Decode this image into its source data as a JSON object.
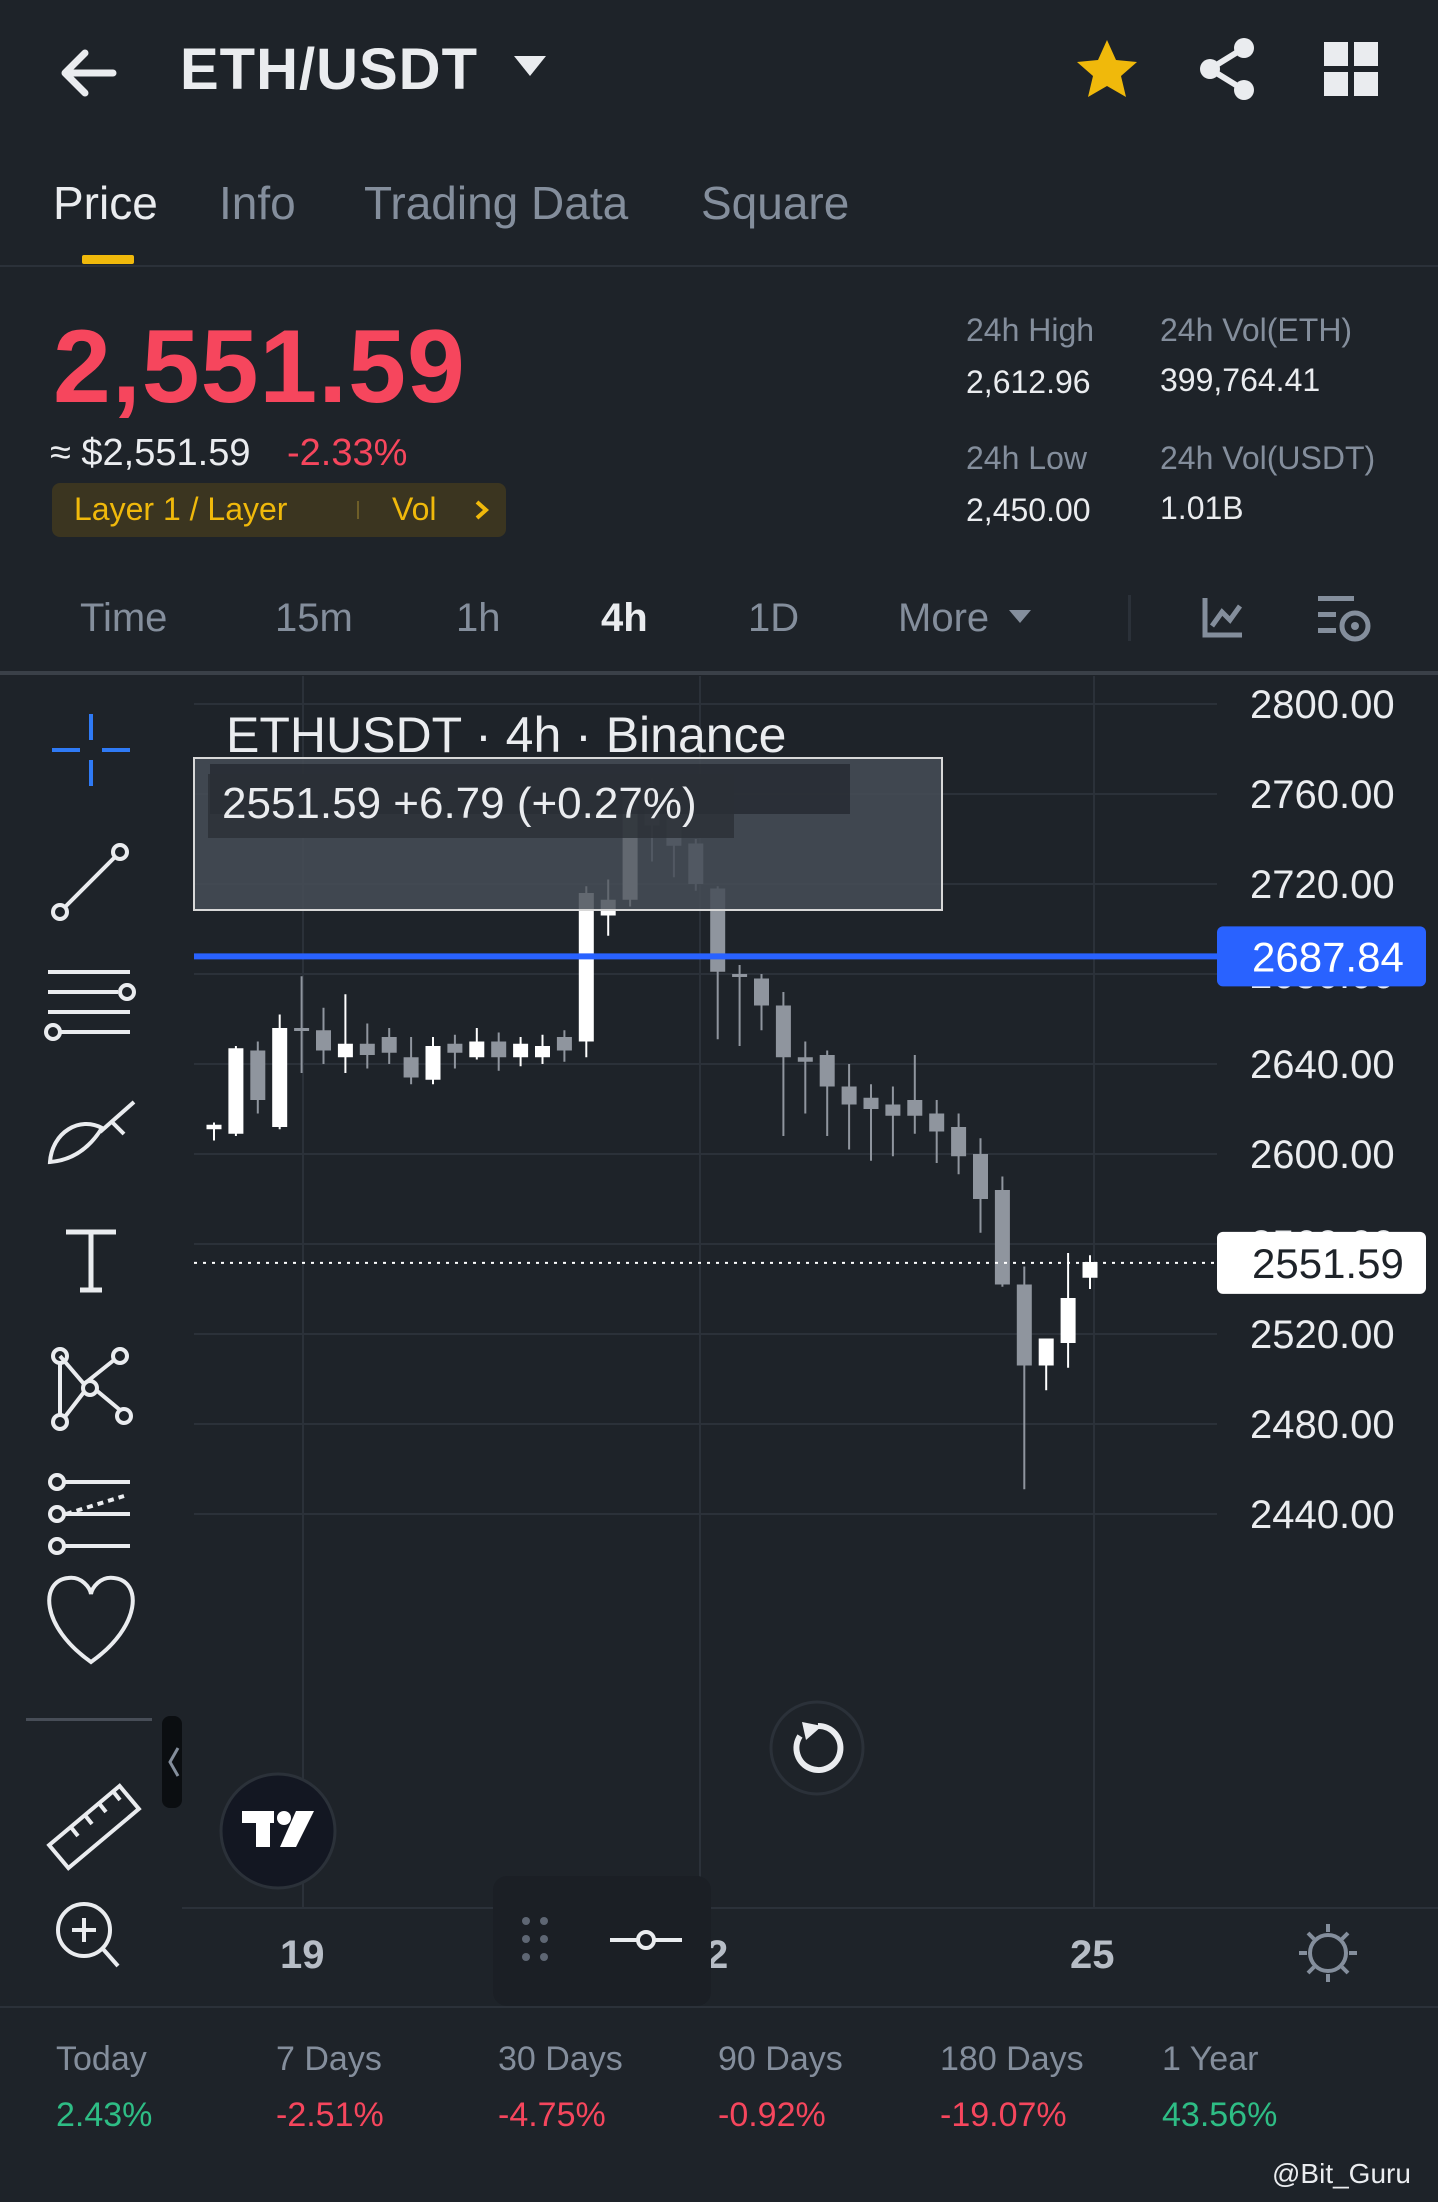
{
  "header": {
    "pair": "ETH/USDT",
    "accent": "#f0b90b"
  },
  "tabs": [
    {
      "label": "Price"
    },
    {
      "label": "Info"
    },
    {
      "label": "Trading Data"
    },
    {
      "label": "Square"
    }
  ],
  "price": {
    "last": "2,551.59",
    "usd": "≈ $2,551.59",
    "change": "-2.33%",
    "tag": "Layer 1 / Layer",
    "vol_link": "Vol",
    "down_color": "#f6465d",
    "up_color": "#2ebd85"
  },
  "stats": {
    "high_label": "24h High",
    "high_value": "2,612.96",
    "vol_eth_label": "24h Vol(ETH)",
    "vol_eth_value": "399,764.41",
    "low_label": "24h Low",
    "low_value": "2,450.00",
    "vol_usdt_label": "24h Vol(USDT)",
    "vol_usdt_value": "1.01B"
  },
  "timeframes": [
    "Time",
    "15m",
    "1h",
    "4h",
    "1D",
    "More"
  ],
  "active_timeframe": "4h",
  "chart": {
    "legend_title": "ETHUSDT · 4h · Binance",
    "legend_values": "2551.59  +6.79 (+0.27%)",
    "alert_line_label": "2687.84",
    "last_price_label": "2551.59",
    "x_labels": [
      "19",
      "2",
      "25"
    ]
  },
  "chart_data": {
    "type": "candlestick",
    "title": "ETHUSDT · 4h · Binance",
    "ylim": [
      2420,
      2820
    ],
    "y_ticks": [
      "2800.00",
      "2760.00",
      "2720.00",
      "2680.00",
      "2640.00",
      "2600.00",
      "2560.00",
      "2520.00",
      "2480.00",
      "2440.00"
    ],
    "x_labels": [
      "19",
      "2",
      "25"
    ],
    "horizontal_lines": [
      {
        "value": 2687.84,
        "color": "#2962ff"
      },
      {
        "value": 2551.59,
        "style": "dotted"
      }
    ],
    "candles": [
      {
        "o": 2611,
        "h": 2614,
        "l": 2606,
        "c": 2613
      },
      {
        "o": 2609,
        "h": 2648,
        "l": 2608,
        "c": 2647
      },
      {
        "o": 2646,
        "h": 2650,
        "l": 2618,
        "c": 2624
      },
      {
        "o": 2612,
        "h": 2662,
        "l": 2611,
        "c": 2656
      },
      {
        "o": 2656,
        "h": 2679,
        "l": 2636,
        "c": 2655
      },
      {
        "o": 2655,
        "h": 2665,
        "l": 2640,
        "c": 2646
      },
      {
        "o": 2643,
        "h": 2671,
        "l": 2636,
        "c": 2649
      },
      {
        "o": 2649,
        "h": 2658,
        "l": 2638,
        "c": 2644
      },
      {
        "o": 2652,
        "h": 2656,
        "l": 2640,
        "c": 2645
      },
      {
        "o": 2643,
        "h": 2652,
        "l": 2631,
        "c": 2634
      },
      {
        "o": 2633,
        "h": 2652,
        "l": 2631,
        "c": 2648
      },
      {
        "o": 2649,
        "h": 2653,
        "l": 2638,
        "c": 2645
      },
      {
        "o": 2643,
        "h": 2656,
        "l": 2642,
        "c": 2650
      },
      {
        "o": 2650,
        "h": 2654,
        "l": 2637,
        "c": 2643
      },
      {
        "o": 2643,
        "h": 2652,
        "l": 2639,
        "c": 2649
      },
      {
        "o": 2643,
        "h": 2653,
        "l": 2640,
        "c": 2648
      },
      {
        "o": 2652,
        "h": 2655,
        "l": 2641,
        "c": 2646
      },
      {
        "o": 2650,
        "h": 2719,
        "l": 2643,
        "c": 2716
      },
      {
        "o": 2706,
        "h": 2722,
        "l": 2697,
        "c": 2713
      },
      {
        "o": 2713,
        "h": 2763,
        "l": 2710,
        "c": 2759
      },
      {
        "o": 2760,
        "h": 2767,
        "l": 2730,
        "c": 2746
      },
      {
        "o": 2749,
        "h": 2759,
        "l": 2723,
        "c": 2737
      },
      {
        "o": 2738,
        "h": 2740,
        "l": 2717,
        "c": 2720
      },
      {
        "o": 2718,
        "h": 2719,
        "l": 2651,
        "c": 2681
      },
      {
        "o": 2680,
        "h": 2684,
        "l": 2648,
        "c": 2679
      },
      {
        "o": 2678,
        "h": 2680,
        "l": 2655,
        "c": 2666
      },
      {
        "o": 2666,
        "h": 2672,
        "l": 2608,
        "c": 2643
      },
      {
        "o": 2643,
        "h": 2650,
        "l": 2618,
        "c": 2641
      },
      {
        "o": 2644,
        "h": 2646,
        "l": 2608,
        "c": 2630
      },
      {
        "o": 2630,
        "h": 2640,
        "l": 2602,
        "c": 2622
      },
      {
        "o": 2625,
        "h": 2631,
        "l": 2597,
        "c": 2620
      },
      {
        "o": 2622,
        "h": 2630,
        "l": 2599,
        "c": 2617
      },
      {
        "o": 2624,
        "h": 2644,
        "l": 2609,
        "c": 2617
      },
      {
        "o": 2618,
        "h": 2624,
        "l": 2596,
        "c": 2610
      },
      {
        "o": 2612,
        "h": 2618,
        "l": 2591,
        "c": 2599
      },
      {
        "o": 2600,
        "h": 2607,
        "l": 2565,
        "c": 2580
      },
      {
        "o": 2584,
        "h": 2590,
        "l": 2541,
        "c": 2542
      },
      {
        "o": 2542,
        "h": 2550,
        "l": 2451,
        "c": 2506
      },
      {
        "o": 2506,
        "h": 2517,
        "l": 2495,
        "c": 2518
      },
      {
        "o": 2516,
        "h": 2556,
        "l": 2505,
        "c": 2536
      },
      {
        "o": 2545,
        "h": 2555,
        "l": 2540,
        "c": 2552
      }
    ]
  },
  "performance": [
    {
      "label": "Today",
      "value": "2.43%",
      "sign": "pos"
    },
    {
      "label": "7 Days",
      "value": "-2.51%",
      "sign": "neg"
    },
    {
      "label": "30 Days",
      "value": "-4.75%",
      "sign": "neg"
    },
    {
      "label": "90 Days",
      "value": "-0.92%",
      "sign": "neg"
    },
    {
      "label": "180 Days",
      "value": "-19.07%",
      "sign": "neg"
    },
    {
      "label": "1 Year",
      "value": "43.56%",
      "sign": "pos"
    }
  ],
  "watermark": "@Bit_Guru"
}
